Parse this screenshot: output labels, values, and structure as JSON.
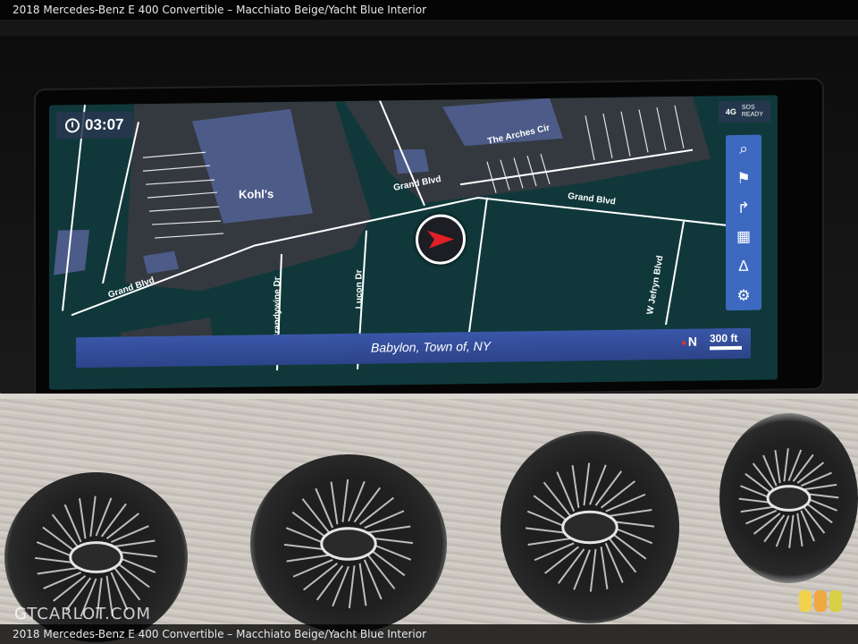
{
  "caption": {
    "top": "2018 Mercedes-Benz E 400 Convertible – Macchiato Beige/Yacht Blue Interior",
    "bottom": "2018 Mercedes-Benz E 400 Convertible – Macchiato Beige/Yacht Blue Interior"
  },
  "nav_screen": {
    "clock": {
      "icon": "clock-icon",
      "time": "03:07"
    },
    "status": {
      "network": "4G",
      "sos_line1": "SOS",
      "sos_line2": "READY"
    },
    "side_menu": [
      {
        "icon": "search-icon",
        "glyph": "⌕"
      },
      {
        "icon": "flag-icon",
        "glyph": "⚑"
      },
      {
        "icon": "route-audio-icon",
        "glyph": "↱"
      },
      {
        "icon": "map-layers-icon",
        "glyph": "▦"
      },
      {
        "icon": "road-view-icon",
        "glyph": "∆"
      },
      {
        "icon": "settings-gear-icon",
        "glyph": "⚙"
      }
    ],
    "streets": {
      "grand_blvd_1": "Grand Blvd",
      "grand_blvd_2": "Grand Blvd",
      "grand_blvd_3": "Grand Blvd",
      "arches_cir": "The Arches Cir",
      "brandywine": "Brandywine Dr",
      "lucon": "Lucon Dr",
      "w_jefryn": "W Jefryn Blvd"
    },
    "poi": {
      "kohls": "Kohl's"
    },
    "location": "Babylon, Town of, NY",
    "compass": "N",
    "scale": "300 ft",
    "colors": {
      "map_bg": "#10383a",
      "blocks": "#34393f",
      "parking": "#4c5b87",
      "accent_blue": "#3d6ac0",
      "marker": "#e21f26"
    }
  },
  "watermark": "GTCARLOT.COM"
}
